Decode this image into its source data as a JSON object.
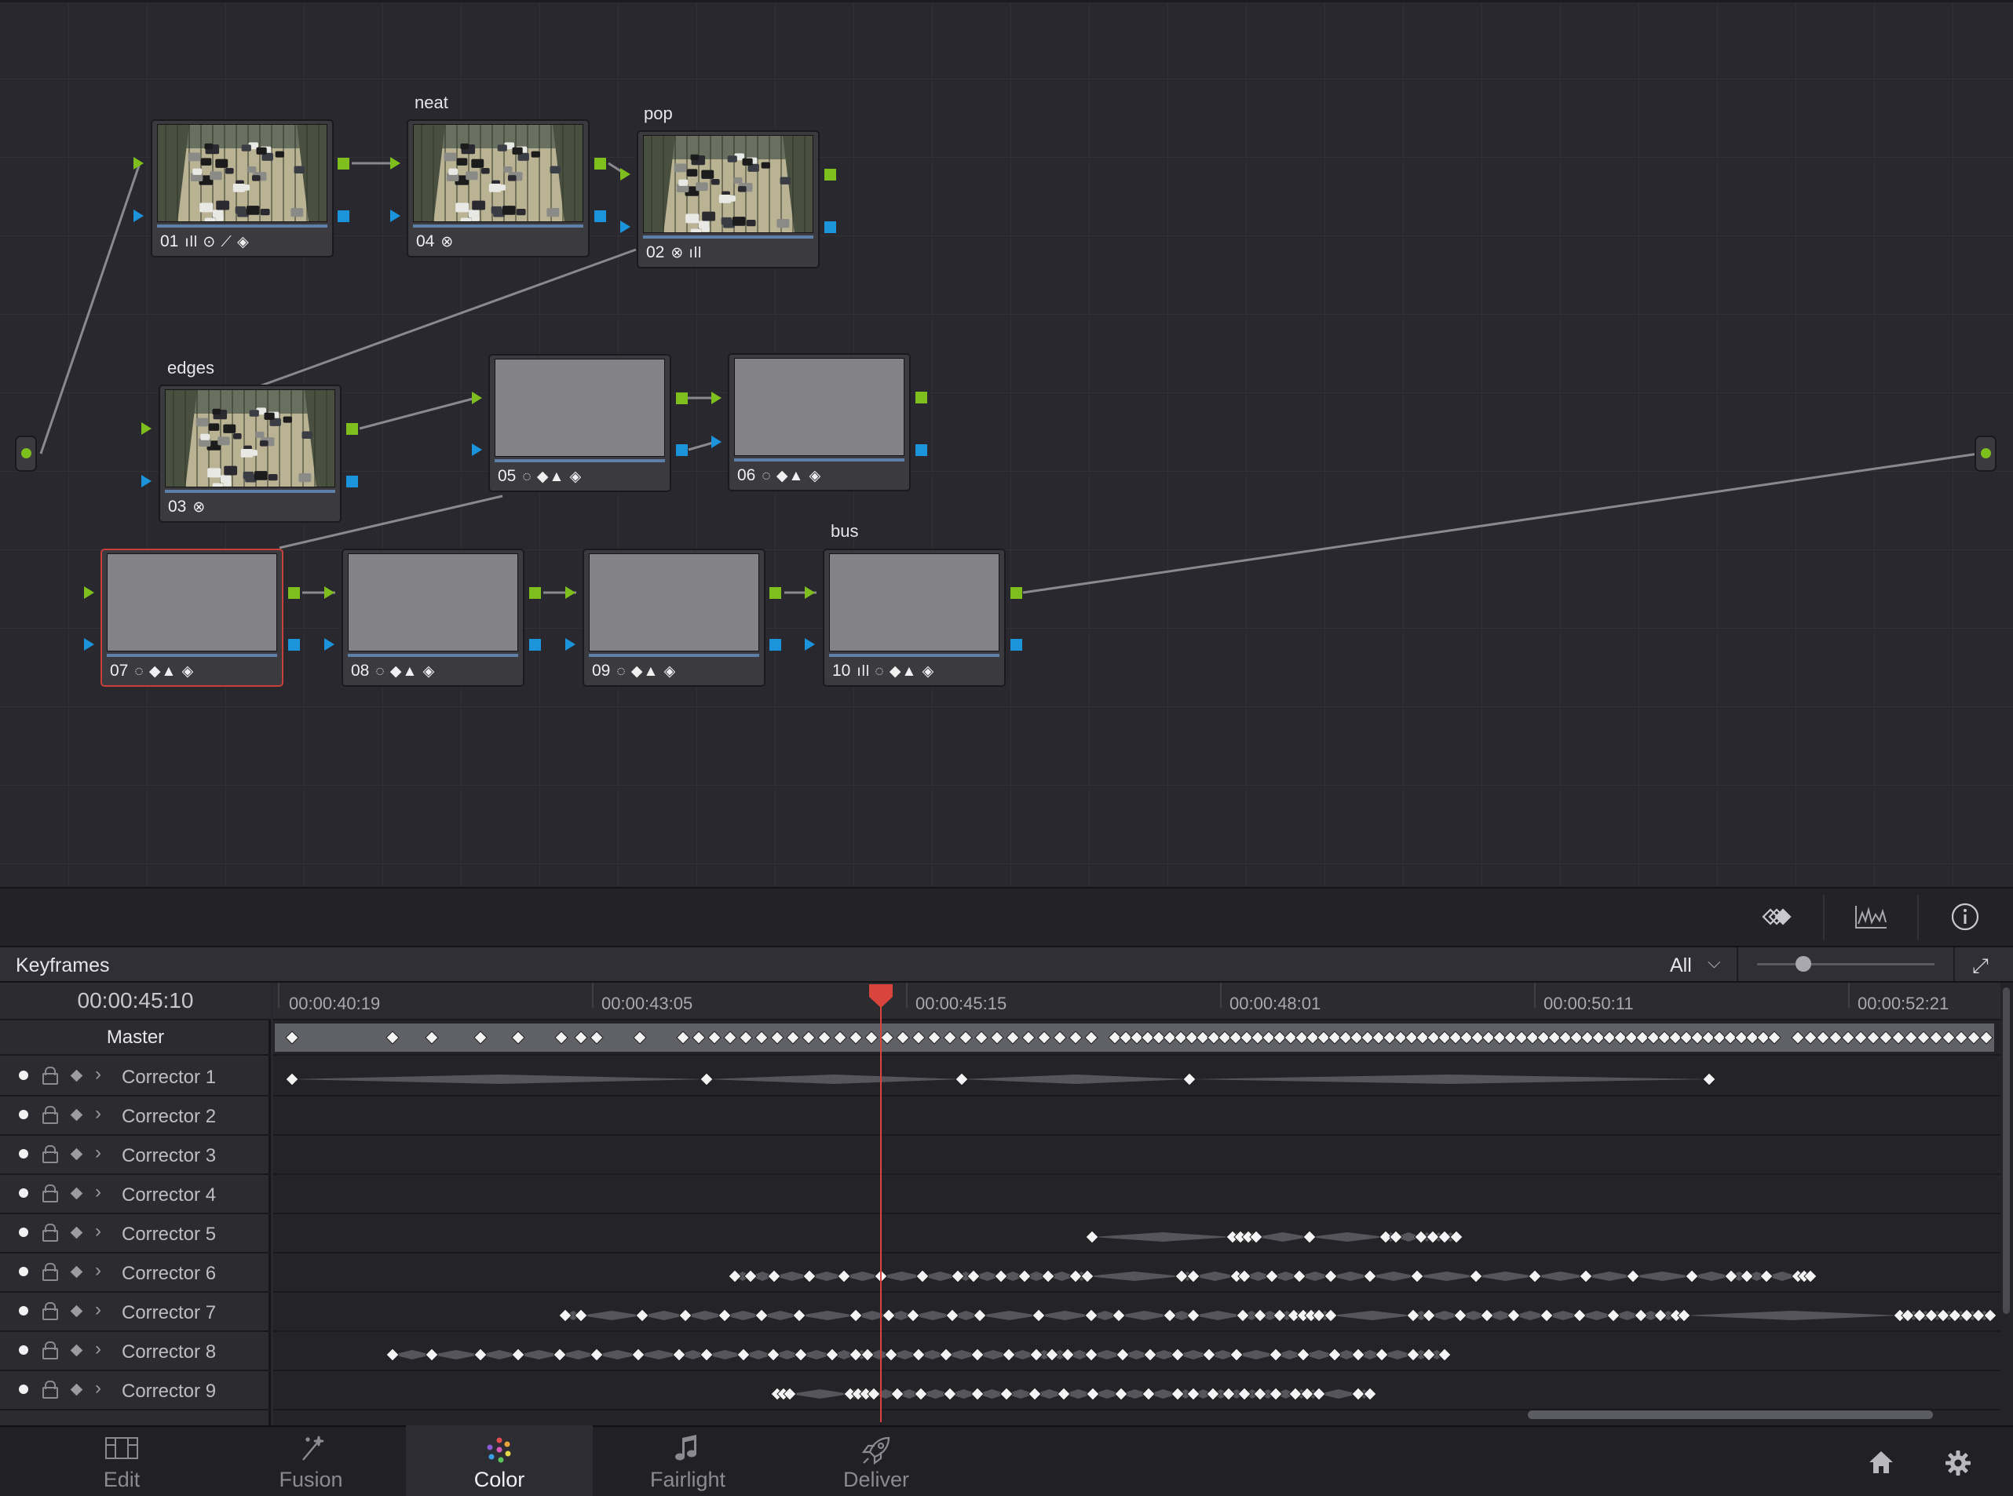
{
  "node_editor": {
    "nodes": [
      {
        "id": "01",
        "label": "",
        "tools": "ıll ⊙ ⟋ ◈",
        "thumb": "traffic"
      },
      {
        "id": "04",
        "label": "neat",
        "tools": "⊗",
        "thumb": "traffic"
      },
      {
        "id": "02",
        "label": "pop",
        "tools": "⊗ ıll",
        "thumb": "traffic"
      },
      {
        "id": "03",
        "label": "edges",
        "tools": "⊗",
        "thumb": "traffic"
      },
      {
        "id": "05",
        "label": "",
        "tools": "◌ ◆▲ ◈",
        "thumb": "gray"
      },
      {
        "id": "06",
        "label": "",
        "tools": "◌ ◆▲ ◈",
        "thumb": "gray"
      },
      {
        "id": "07",
        "label": "",
        "tools": "◌ ◆▲ ◈",
        "thumb": "gray",
        "selected": true
      },
      {
        "id": "08",
        "label": "",
        "tools": "◌ ◆▲ ◈",
        "thumb": "gray"
      },
      {
        "id": "09",
        "label": "",
        "tools": "◌ ◆▲ ◈",
        "thumb": "gray"
      },
      {
        "id": "10",
        "label": "bus",
        "tools": "ıll ◌ ◆▲ ◈",
        "thumb": "gray"
      }
    ]
  },
  "toolbar": {
    "icons": [
      "keyframes-icon",
      "curves-icon",
      "info-icon"
    ]
  },
  "keyframes_panel": {
    "title": "Keyframes",
    "filter": "All",
    "timecode": "00:00:45:10",
    "ruler": [
      "00:00:40:19",
      "00:00:43:05",
      "00:00:45:15",
      "00:00:48:01",
      "00:00:50:11",
      "00:00:52:21"
    ],
    "master_label": "Master",
    "tracks": [
      "Corrector 1",
      "Corrector 2",
      "Corrector 3",
      "Corrector 4",
      "Corrector 5",
      "Corrector 6",
      "Corrector 7",
      "Corrector 8",
      "Corrector 9"
    ],
    "playhead_color": "#d9453d"
  },
  "pages": [
    {
      "label": "Edit",
      "icon": "edit-icon"
    },
    {
      "label": "Fusion",
      "icon": "fusion-icon"
    },
    {
      "label": "Color",
      "icon": "color-icon",
      "active": true
    },
    {
      "label": "Fairlight",
      "icon": "fairlight-icon"
    },
    {
      "label": "Deliver",
      "icon": "deliver-icon"
    }
  ],
  "corner_icons": [
    "home-icon",
    "settings-icon"
  ]
}
